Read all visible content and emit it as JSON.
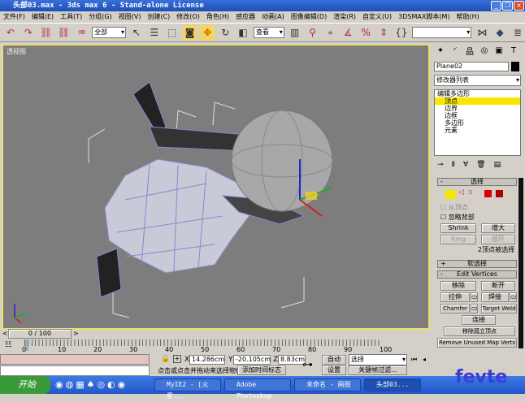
{
  "window": {
    "title": "头部03.max - 3ds max 6 - Stand-alone License"
  },
  "menu": [
    "文件(F)",
    "编辑(E)",
    "工具(T)",
    "分组(G)",
    "视图(V)",
    "创建(C)",
    "修改(O)",
    "角色(H)",
    "感应器",
    "动画(A)",
    "图像编辑(D)",
    "渲染(R)",
    "自定义(U)",
    "3DSMAX脚本(M)",
    "帮助(H)"
  ],
  "toolbar": {
    "selection_filter": "全部",
    "coord_system": "查看",
    "named_selection": ""
  },
  "viewport": {
    "label": "透视图"
  },
  "panel": {
    "object_name": "Plane02",
    "object_color": "#000000",
    "modifier_list": "修改器列表",
    "stack": {
      "root": "编辑多边形",
      "items": [
        "顶点",
        "边界",
        "边框",
        "多边形",
        "元素"
      ],
      "selected": "顶点"
    },
    "selection": {
      "title": "选择",
      "by_vertex": "从顶点",
      "ignore_backfacing": "忽略背部",
      "shrink": "Shrink",
      "grow": "增大",
      "ring": "Ring",
      "loop": "循环",
      "status": "2顶点被选择"
    },
    "soft_selection": {
      "title": "软选择"
    },
    "edit_vertices": {
      "title": "Edit Vertices",
      "remove": "移除",
      "break": "断开",
      "extrude": "拉伸",
      "weld": "焊接",
      "chamfer": "Chamfer",
      "target_weld": "Target Weld",
      "connect": "连接",
      "remove_isolated": "移除孤立顶点",
      "remove_unused_map": "Remove Unused Map Verts"
    }
  },
  "timeline": {
    "frame": "0 / 100",
    "ticks": [
      "0",
      "10",
      "20",
      "30",
      "40",
      "50",
      "60",
      "70",
      "80",
      "90",
      "100"
    ]
  },
  "status": {
    "x": "14.286cm",
    "y": "-20.105cm",
    "z": "8.83cm",
    "prompt": "点击或点击并拖动来选择物体",
    "add_time_tag": "添加时间标志",
    "auto_key": "自动",
    "set_key": "设置",
    "key_mode": "选择",
    "key_filters": "关键帧过滤..."
  },
  "taskbar": {
    "start": "开始",
    "tasks": [
      "MyIE2 - [火星...",
      "Adobe Photoshop",
      "未命名 - 画图",
      "头部03..."
    ]
  },
  "watermark": "fevte.com"
}
